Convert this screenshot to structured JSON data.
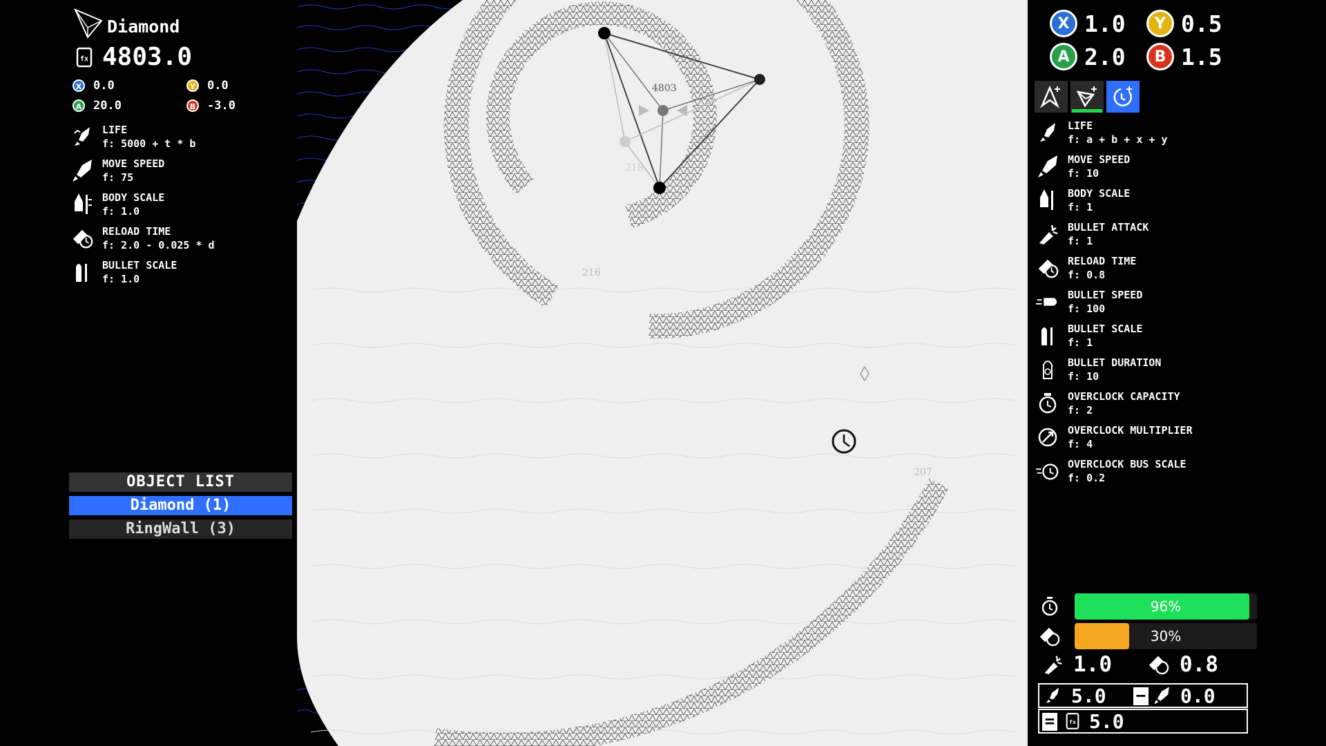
{
  "left": {
    "object_name": "Diamond",
    "score": "4803.0",
    "coins": [
      {
        "letter": "X",
        "value": "0.0"
      },
      {
        "letter": "Y",
        "value": "0.0"
      },
      {
        "letter": "A",
        "value": "20.0"
      },
      {
        "letter": "B",
        "value": "-3.0"
      }
    ],
    "attributes": [
      {
        "label": "LIFE",
        "formula": "f: 5000 + t * b",
        "icon": "rocket-up-icon"
      },
      {
        "label": "MOVE SPEED",
        "formula": "f: 75",
        "icon": "rocket-fast-icon"
      },
      {
        "label": "BODY SCALE",
        "formula": "f: 1.0",
        "icon": "rocket-scale-icon"
      },
      {
        "label": "RELOAD TIME",
        "formula": "f: 2.0 - 0.025 * d",
        "icon": "reload-icon"
      },
      {
        "label": "BULLET SCALE",
        "formula": "f: 1.0",
        "icon": "bullet-scale-icon"
      }
    ],
    "object_list": {
      "title": "OBJECT LIST",
      "items": [
        "Diamond (1)",
        "RingWall (3)"
      ]
    }
  },
  "game": {
    "labels": [
      "4803",
      "218",
      "216",
      "207"
    ]
  },
  "right": {
    "resources": [
      {
        "letter": "X",
        "value": "1.0"
      },
      {
        "letter": "Y",
        "value": "0.5"
      },
      {
        "letter": "A",
        "value": "2.0"
      },
      {
        "letter": "B",
        "value": "1.5"
      }
    ],
    "tabs": [
      "ship-upgrade-tab",
      "diamond-tab",
      "overclock-tab"
    ],
    "attributes": [
      {
        "label": "LIFE",
        "formula": "f: a + b + x + y"
      },
      {
        "label": "MOVE SPEED",
        "formula": "f: 10"
      },
      {
        "label": "BODY SCALE",
        "formula": "f: 1"
      },
      {
        "label": "BULLET ATTACK",
        "formula": "f: 1"
      },
      {
        "label": "RELOAD TIME",
        "formula": "f: 0.8"
      },
      {
        "label": "BULLET SPEED",
        "formula": "f: 100"
      },
      {
        "label": "BULLET SCALE",
        "formula": "f: 1"
      },
      {
        "label": "BULLET DURATION",
        "formula": "f: 10"
      },
      {
        "label": "OVERCLOCK CAPACITY",
        "formula": "f: 2"
      },
      {
        "label": "OVERCLOCK MULTIPLIER",
        "formula": "f: 4"
      },
      {
        "label": "OVERCLOCK BUS SCALE",
        "formula": "f: 0.2"
      }
    ],
    "overclock_bar": {
      "label": "96%",
      "fraction": 0.96,
      "color": "#1fe05a"
    },
    "reload_bar": {
      "label": "30%",
      "fraction": 0.3,
      "color": "#f5a623"
    },
    "attack_value": "1.0",
    "reload_value": "0.8",
    "calc": {
      "left": "5.0",
      "right": "0.0",
      "result": "5.0",
      "minus": "−",
      "equals": "="
    }
  },
  "colors": {
    "x": "#2a6fd6",
    "y": "#e3b413",
    "a": "#26a04a",
    "b": "#d8331c",
    "accent": "#2f6fff"
  }
}
